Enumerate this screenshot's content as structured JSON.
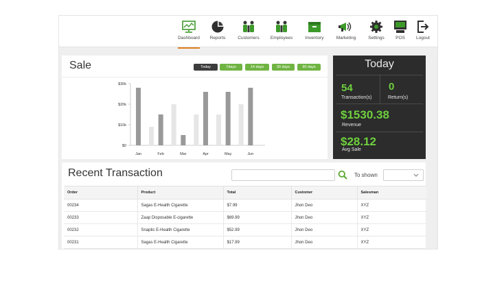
{
  "nav": {
    "items": [
      {
        "label": "Dashboard",
        "icon": "dashboard-icon",
        "active": true
      },
      {
        "label": "Reports",
        "icon": "pie-chart-icon"
      },
      {
        "label": "Customers",
        "icon": "customers-icon"
      },
      {
        "label": "Employees",
        "icon": "employees-icon"
      },
      {
        "label": "Inventory",
        "icon": "inventory-box-icon"
      },
      {
        "label": "Marketing",
        "icon": "megaphone-icon"
      },
      {
        "label": "Settings",
        "icon": "gear-icon"
      },
      {
        "label": "POS",
        "icon": "pos-terminal-icon"
      },
      {
        "label": "Logout",
        "icon": "logout-icon"
      }
    ]
  },
  "sale": {
    "title": "Sale",
    "ranges": [
      "Today",
      "7days",
      "14 days",
      "30 days",
      "90 days"
    ],
    "active_range": "Today"
  },
  "chart_data": {
    "type": "bar",
    "categories": [
      "Jan",
      "Feb",
      "Mar",
      "Apr",
      "May",
      "Jun"
    ],
    "series": [
      {
        "values": [
          28000,
          15000,
          5000,
          26000,
          26000,
          28000
        ]
      },
      {
        "values": [
          9000,
          20000,
          15000,
          15000,
          20000,
          null
        ]
      }
    ],
    "yticks": [
      "$30k",
      "$20k",
      "$10k",
      "$0"
    ],
    "ylim": [
      0,
      30000
    ],
    "grid": false,
    "colors": [
      "#999999",
      "#e6e6e6"
    ]
  },
  "today": {
    "title": "Today",
    "transactions_value": "54",
    "transactions_label": "Transaction(s)",
    "returns_value": "0",
    "returns_label": "Return(s)",
    "revenue_value": "$1530.38",
    "revenue_label": "Revenue",
    "avg_value": "$28.12",
    "avg_label": "Avg Sale"
  },
  "recent": {
    "title": "Recent Transaction",
    "search_placeholder": "",
    "to_shown_label": "To shown",
    "shown_value": ""
  },
  "table": {
    "columns": [
      "Order",
      "Product",
      "Total",
      "Customer",
      "Salesman"
    ],
    "rows": [
      [
        "00234",
        "Sagas E-Health Cigarette",
        "$7.99",
        "Jhon Deo",
        "XYZ"
      ],
      [
        "00233",
        "Zaap Disposable E-cigarette",
        "$69.99",
        "Jhon Deo",
        "XYZ"
      ],
      [
        "00232",
        "Snaptic E-Health Cigarette",
        "$52.99",
        "Jhon Deo",
        "XYZ"
      ],
      [
        "00231",
        "Sagas E-Health Cigarette",
        "$17.99",
        "Jhon Deo",
        "XYZ"
      ]
    ]
  },
  "colors": {
    "accent_green": "#6fb443",
    "today_value_green": "#6fcf3e",
    "dark_panel": "#2b2c2b",
    "active_tab_underline": "#e07f1b"
  }
}
